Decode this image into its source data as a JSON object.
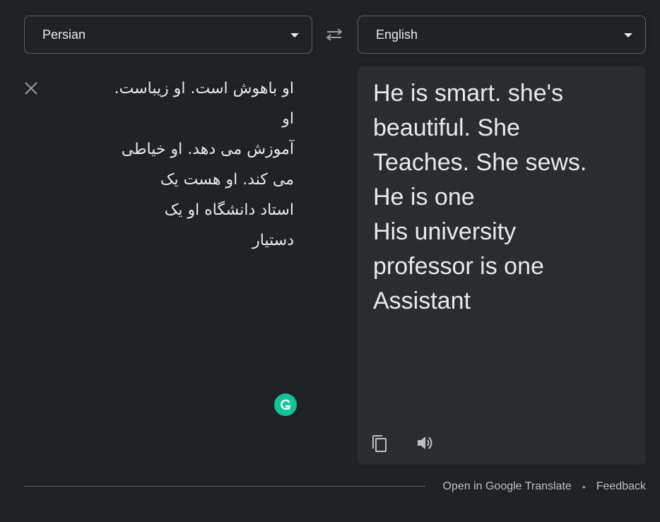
{
  "source_language": {
    "label": "Persian",
    "icon": "chevron-down-icon"
  },
  "target_language": {
    "label": "English",
    "icon": "chevron-down-icon"
  },
  "swap": {
    "icon": "swap-languages-icon"
  },
  "source": {
    "text": "او باهوش است. او زیباست.\nاو\nآموزش می دهد. او خیاطی\nمی کند. او هست یک\nاستاد دانشگاه او یک\nدستیار",
    "clear_icon": "close-icon",
    "grammarly_icon": "grammarly-icon"
  },
  "translation": {
    "text": "He is smart. she's\nbeautiful. She\nTeaches. She sews.\nHe is one\nHis university\nprofessor is one\nAssistant",
    "copy_icon": "copy-icon",
    "listen_icon": "speaker-icon"
  },
  "footer": {
    "open_link": "Open in Google Translate",
    "separator": "•",
    "feedback_link": "Feedback"
  },
  "colors": {
    "background": "#202124",
    "panel": "#2b2c2f",
    "border": "#5f6368",
    "text": "#e8eaed",
    "grammarly": "#15c39a"
  }
}
